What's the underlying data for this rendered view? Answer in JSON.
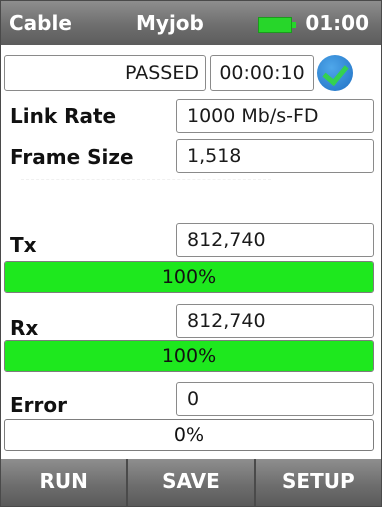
{
  "header": {
    "left_title": "Cable",
    "job_name": "Myjob",
    "battery_icon": "battery-full-icon",
    "battery_color": "#27d62a",
    "clock": "01:00"
  },
  "status": {
    "result": "PASSED",
    "elapsed": "00:00:10",
    "result_icon": "check-circle-icon"
  },
  "fields": {
    "link_rate_label": "Link Rate",
    "link_rate_value": "1000 Mb/s-FD",
    "frame_size_label": "Frame Size",
    "frame_size_value": "1,518"
  },
  "tx": {
    "label": "Tx",
    "count": "812,740",
    "percent_text": "100%",
    "percent": 100
  },
  "rx": {
    "label": "Rx",
    "count": "812,740",
    "percent_text": "100%",
    "percent": 100
  },
  "error": {
    "label": "Error",
    "count": "0",
    "percent_text": "0%",
    "percent": 0
  },
  "colors": {
    "bar_fill": "#1ee81e",
    "accent_blue": "#1f70c4",
    "toolbar": "#6e6e6e"
  },
  "footer": {
    "run_label": "RUN",
    "save_label": "SAVE",
    "setup_label": "SETUP"
  }
}
